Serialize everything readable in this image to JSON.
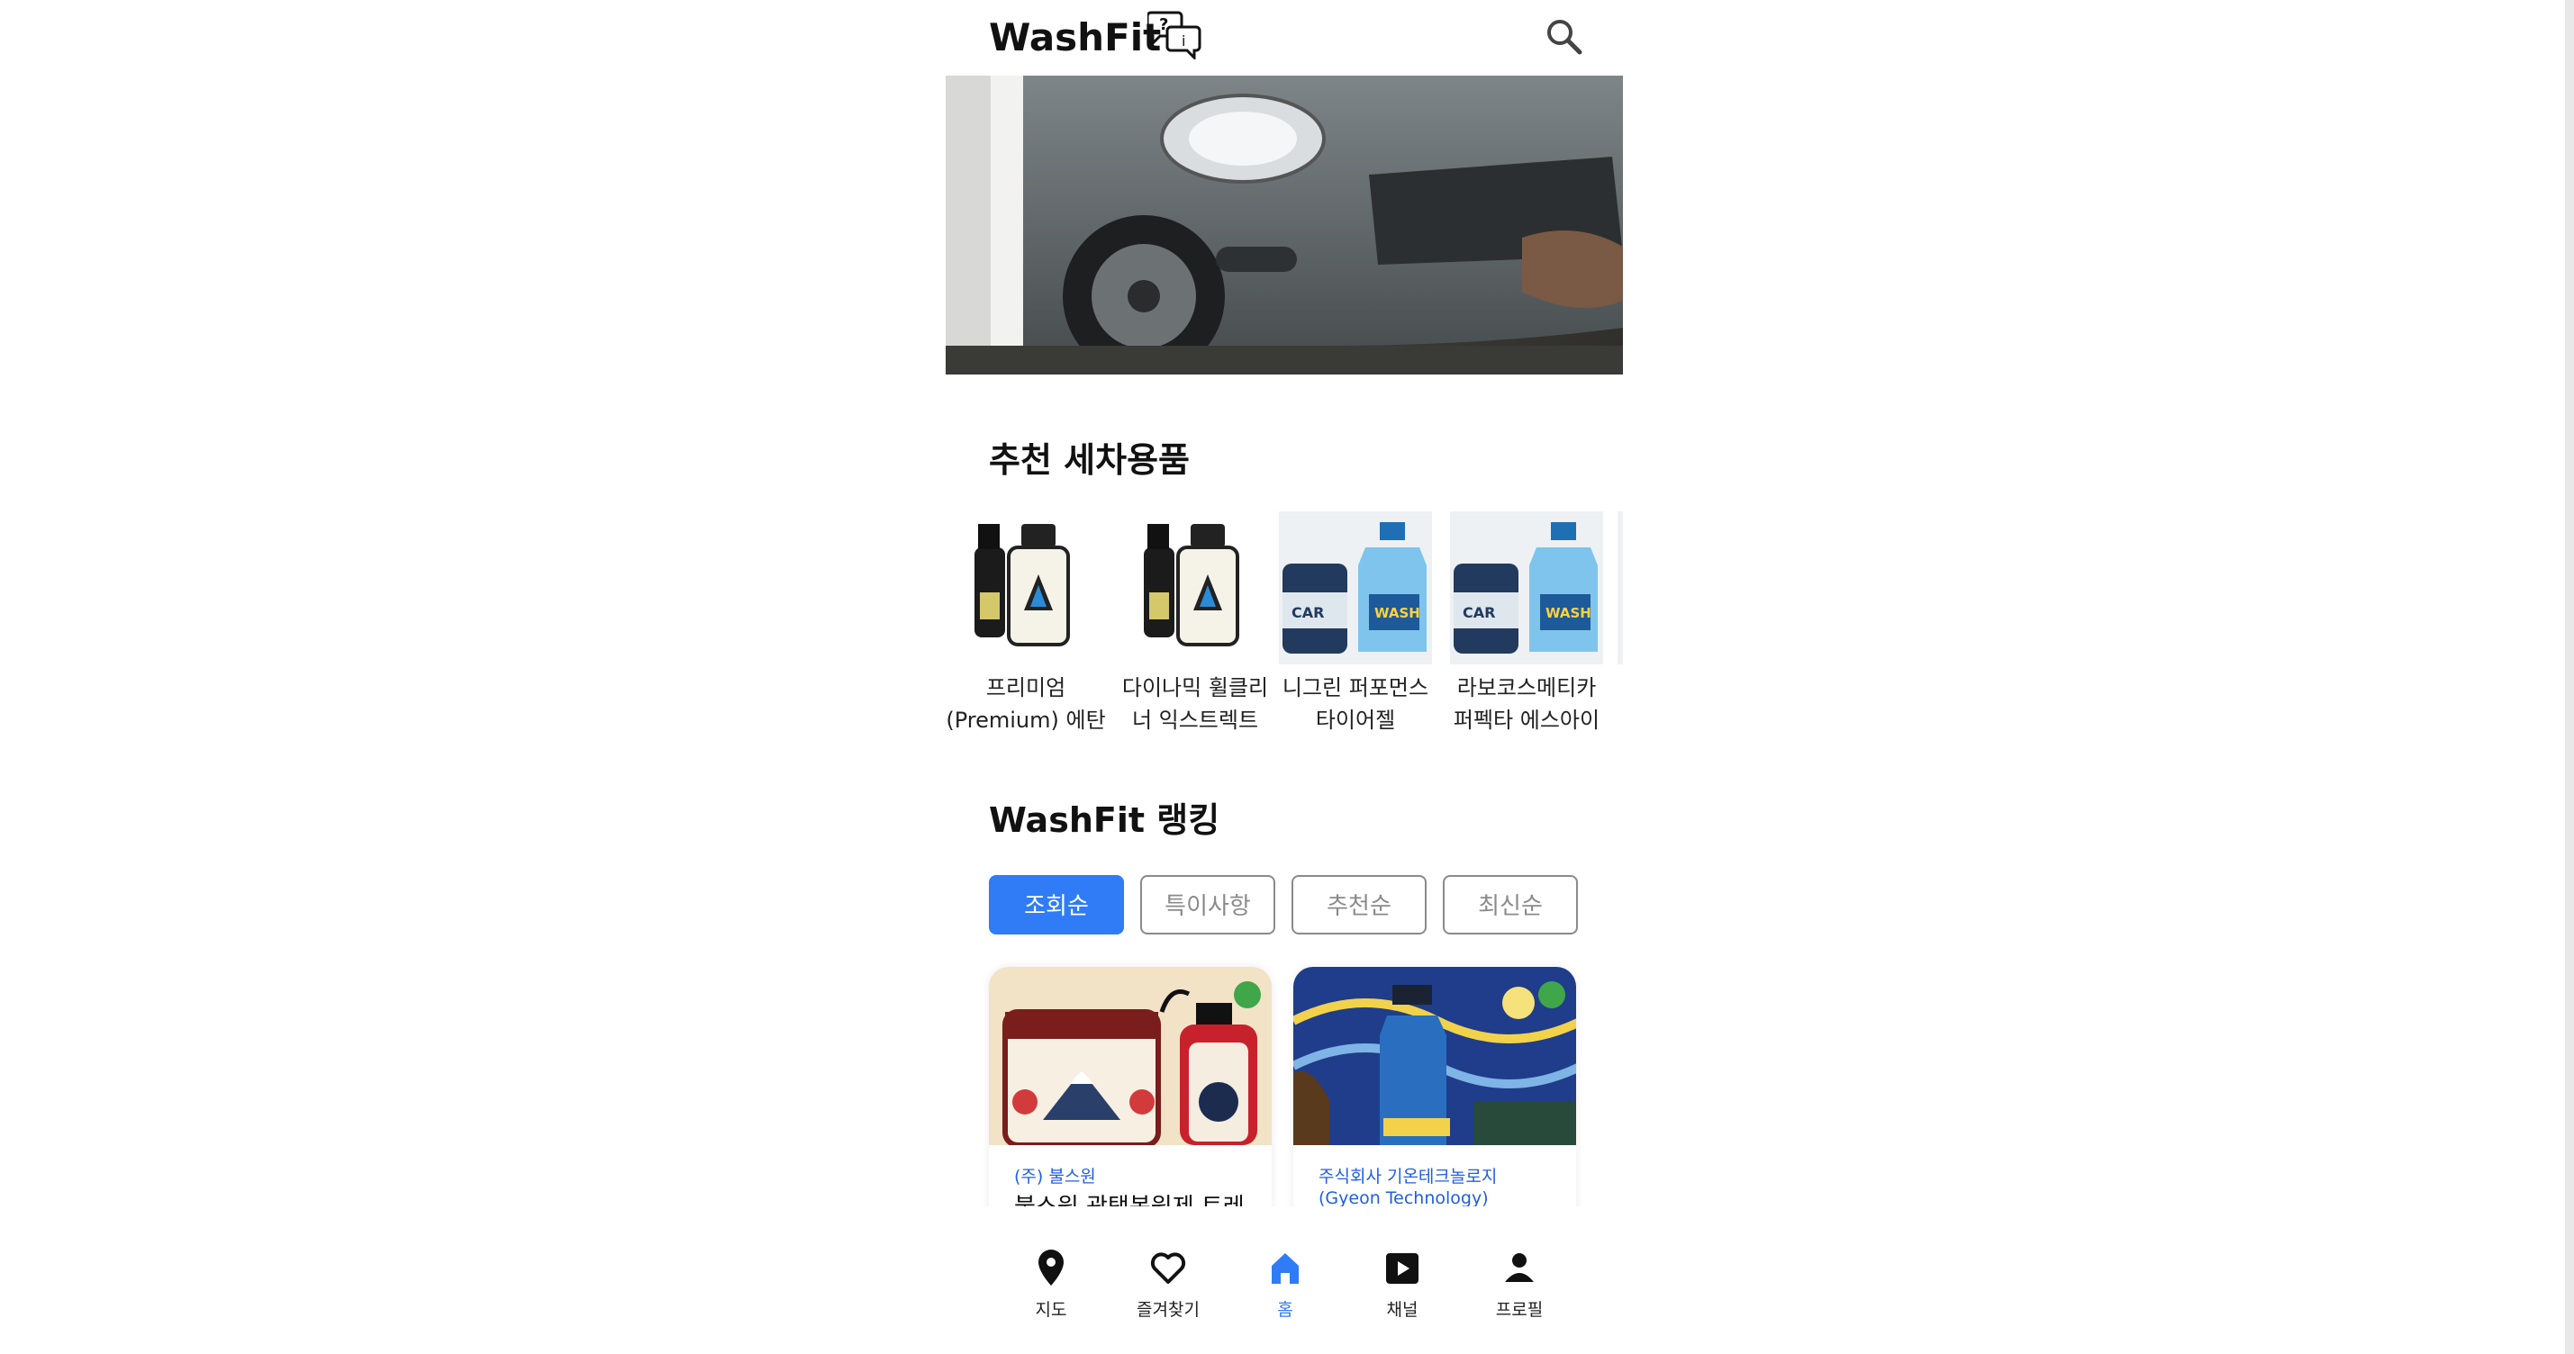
{
  "header": {
    "brand": "WashFit"
  },
  "recommended": {
    "title": "추천 세차용품",
    "items": [
      {
        "label": "프리미엄\n(Premium) 에탄"
      },
      {
        "label": "다이나믹 휠클리\n너 익스트렉트"
      },
      {
        "label": "니그린 퍼포먼스\n타이어젤"
      },
      {
        "label": "라보코스메티카\n퍼펙타 에스아이"
      }
    ]
  },
  "ranking": {
    "title": "WashFit 랭킹",
    "tabs": [
      {
        "label": "조회순",
        "active": true
      },
      {
        "label": "특이사항",
        "active": false
      },
      {
        "label": "추천순",
        "active": false
      },
      {
        "label": "최신순",
        "active": false
      }
    ],
    "cards": [
      {
        "brand": "(주) 불스원",
        "title": "불스원 광택복원제 트레"
      },
      {
        "brand": "주식회사 기온테크놀로지",
        "brand2": "(Gyeon Technology)",
        "title": ""
      }
    ]
  },
  "bottom_nav": [
    {
      "label": "지도",
      "icon": "map-pin-icon",
      "active": false
    },
    {
      "label": "즐겨찾기",
      "icon": "heart-icon",
      "active": false
    },
    {
      "label": "홈",
      "icon": "home-icon",
      "active": true
    },
    {
      "label": "채널",
      "icon": "play-icon",
      "active": false
    },
    {
      "label": "프로필",
      "icon": "user-icon",
      "active": false
    }
  ],
  "colors": {
    "accent": "#2f7cf6",
    "badge": "#3fa64a",
    "brand_text": "#1f5fe0"
  }
}
